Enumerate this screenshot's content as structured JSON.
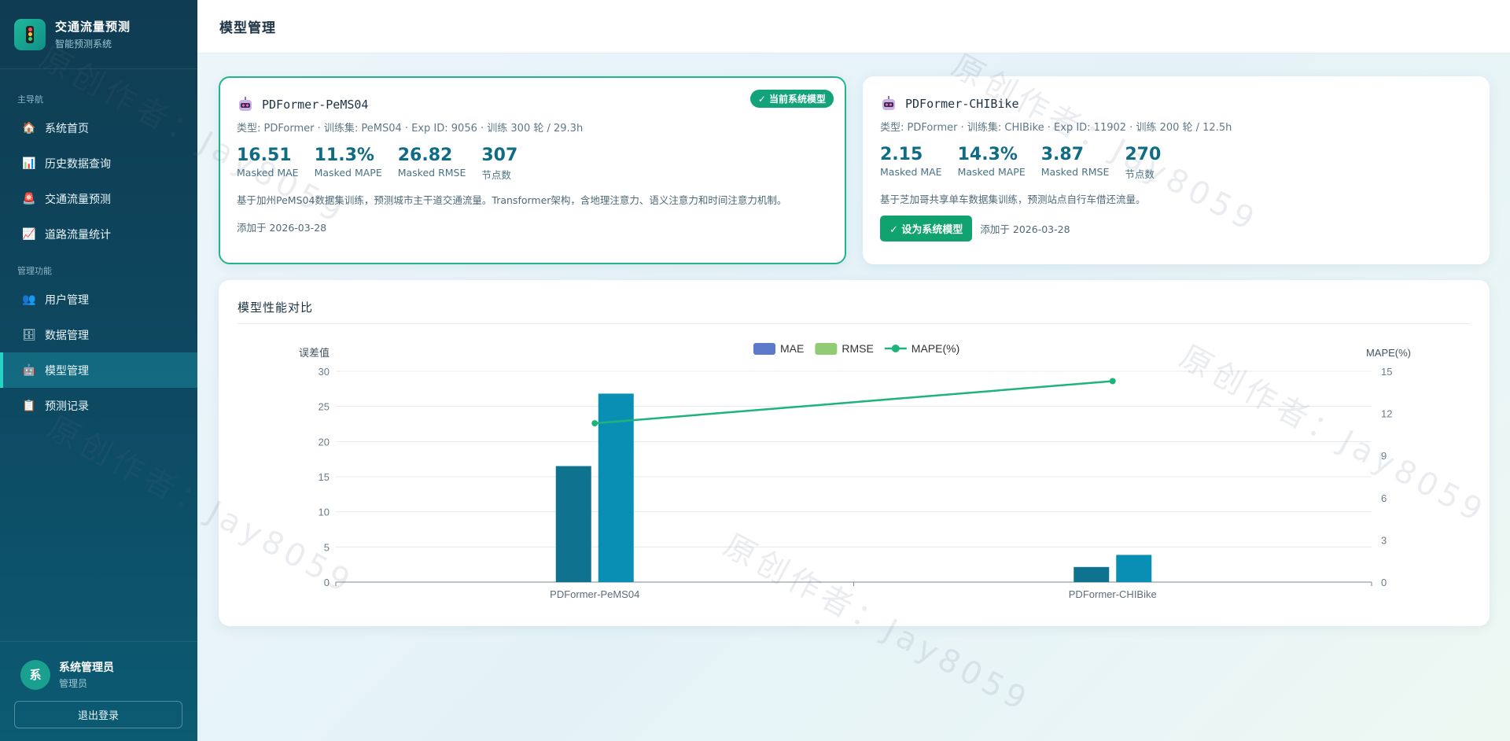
{
  "app": {
    "title": "交通流量预测",
    "subtitle": "智能预测系统"
  },
  "sidebar": {
    "section_main": "主导航",
    "section_admin": "管理功能",
    "main_items": [
      {
        "label": "系统首页",
        "icon": "home-icon"
      },
      {
        "label": "历史数据查询",
        "icon": "bar-chart-icon"
      },
      {
        "label": "交通流量预测",
        "icon": "prediction-icon"
      },
      {
        "label": "道路流量统计",
        "icon": "line-chart-icon"
      }
    ],
    "admin_items": [
      {
        "label": "用户管理",
        "icon": "users-icon"
      },
      {
        "label": "数据管理",
        "icon": "database-icon"
      },
      {
        "label": "模型管理",
        "icon": "robot-icon",
        "active": true
      },
      {
        "label": "预测记录",
        "icon": "clipboard-icon"
      }
    ]
  },
  "user": {
    "avatar_char": "系",
    "name": "系统管理员",
    "role": "管理员",
    "logout_label": "退出登录"
  },
  "header": {
    "title": "模型管理"
  },
  "models": [
    {
      "name": "PDFormer-PeMS04",
      "meta": "类型: PDFormer · 训练集: PeMS04 · Exp ID: 9056 · 训练 300 轮 / 29.3h",
      "badge": "✓ 当前系统模型",
      "metrics": [
        {
          "value": "16.51",
          "label": "Masked MAE"
        },
        {
          "value": "11.3%",
          "label": "Masked MAPE"
        },
        {
          "value": "26.82",
          "label": "Masked RMSE"
        },
        {
          "value": "307",
          "label": "节点数"
        }
      ],
      "description": "基于加州PeMS04数据集训练，预测城市主干道交通流量。Transformer架构，含地理注意力、语义注意力和时间注意力机制。",
      "added": "添加于 2026-03-28"
    },
    {
      "name": "PDFormer-CHIBike",
      "meta": "类型: PDFormer · 训练集: CHIBike · Exp ID: 11902 · 训练 200 轮 / 12.5h",
      "metrics": [
        {
          "value": "2.15",
          "label": "Masked MAE"
        },
        {
          "value": "14.3%",
          "label": "Masked MAPE"
        },
        {
          "value": "3.87",
          "label": "Masked RMSE"
        },
        {
          "value": "270",
          "label": "节点数"
        }
      ],
      "description": "基于芝加哥共享单车数据集训练，预测站点自行车借还流量。",
      "set_button": "✓ 设为系统模型",
      "added": "添加于 2026-03-28"
    }
  ],
  "chart_title": "模型性能对比",
  "chart_data": {
    "type": "bar",
    "categories": [
      "PDFormer-PeMS04",
      "PDFormer-CHIBike"
    ],
    "series": [
      {
        "name": "MAE",
        "type": "bar",
        "axis": "left",
        "color": "#0f7390",
        "values": [
          16.51,
          2.15
        ]
      },
      {
        "name": "RMSE",
        "type": "bar",
        "axis": "left",
        "color": "#0a8fb4",
        "values": [
          26.82,
          3.87
        ]
      },
      {
        "name": "MAPE(%)",
        "type": "line",
        "axis": "right",
        "color": "#1fb37c",
        "values": [
          11.3,
          14.3
        ]
      }
    ],
    "legend": [
      {
        "name": "MAE",
        "color": "#5b7ac9",
        "shape": "box"
      },
      {
        "name": "RMSE",
        "color": "#91cc75",
        "shape": "box"
      },
      {
        "name": "MAPE(%)",
        "color": "#1fb37c",
        "shape": "line"
      }
    ],
    "ylabel": "误差值",
    "y2label": "MAPE(%)",
    "ylim": [
      0,
      30
    ],
    "y_ticks": [
      0,
      5,
      10,
      15,
      20,
      25,
      30
    ],
    "y2lim": [
      0,
      15
    ],
    "y2_ticks": [
      0,
      3,
      6,
      9,
      12,
      15
    ],
    "grid": true,
    "legend_position": "top-center"
  },
  "watermark": "原创作者：Jay8059"
}
